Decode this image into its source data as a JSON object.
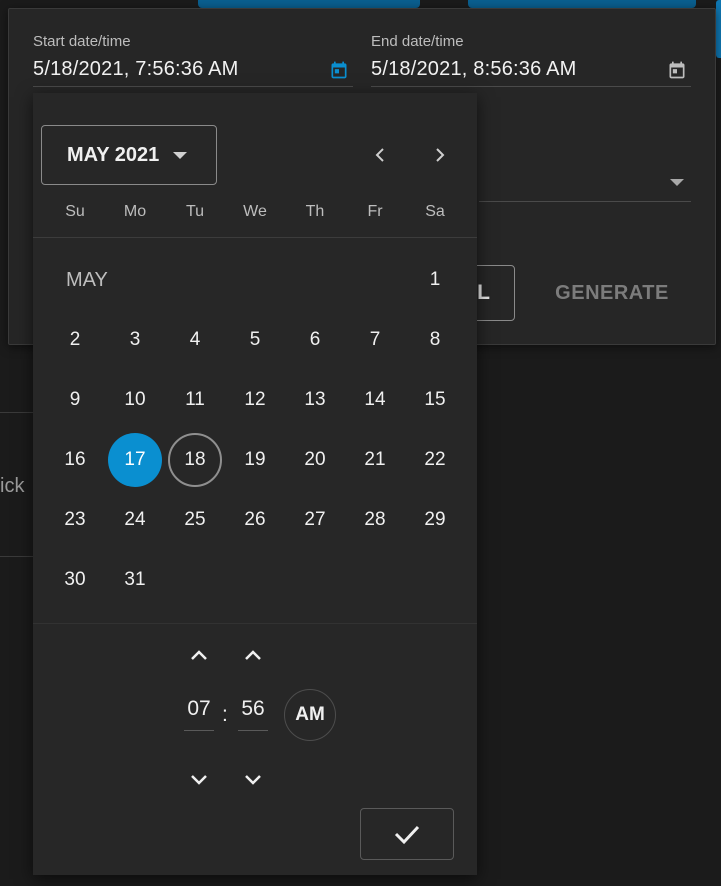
{
  "background": {
    "partial_text": "ick"
  },
  "dialog": {
    "start": {
      "label": "Start date/time",
      "value": "5/18/2021, 7:56:36 AM",
      "icon": "calendar-icon"
    },
    "end": {
      "label": "End date/time",
      "value": "5/18/2021, 8:56:36 AM",
      "icon": "calendar-icon"
    },
    "cancel_label_visible": "L",
    "generate_label": "GENERATE"
  },
  "picker": {
    "month_year": "MAY 2021",
    "weekdays": [
      "Su",
      "Mo",
      "Tu",
      "We",
      "Th",
      "Fr",
      "Sa"
    ],
    "month_label": "MAY",
    "days": [
      "1",
      "2",
      "3",
      "4",
      "5",
      "6",
      "7",
      "8",
      "9",
      "10",
      "11",
      "12",
      "13",
      "14",
      "15",
      "16",
      "17",
      "18",
      "19",
      "20",
      "21",
      "22",
      "23",
      "24",
      "25",
      "26",
      "27",
      "28",
      "29",
      "30",
      "31"
    ],
    "selected_day": "17",
    "today_day": "18",
    "time": {
      "hour": "07",
      "separator": ":",
      "minute": "56",
      "ampm": "AM"
    }
  },
  "colors": {
    "accent": "#0a8fd0",
    "calendar_icon_start": "#0a8fd0",
    "calendar_icon_end": "#bdbdbd"
  }
}
